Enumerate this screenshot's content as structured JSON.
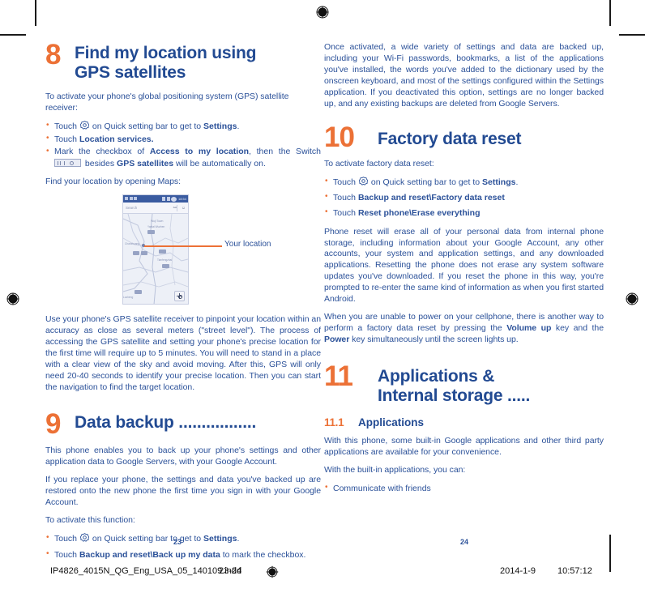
{
  "document": {
    "left_page": {
      "chapters": [
        {
          "number": "8",
          "title_line1": "Find my location using",
          "title_line2": "GPS satellites",
          "intro": "To activate your phone's global positioning system (GPS) satellite receiver:",
          "bullets": [
            {
              "pre": "Touch ",
              "icon": "gear-icon",
              "mid": " on Quick setting bar to get to ",
              "bold": "Settings",
              "post": "."
            },
            {
              "pre": "Touch ",
              "bold": "Location services.",
              "post": ""
            },
            {
              "pre": "Mark the checkbox of ",
              "bold": "Access to my location",
              "mid2": ", then the Switch ",
              "icon2": "toggle-switch-icon",
              "mid3": " besides ",
              "bold2": "GPS satellites",
              "post": " will be automatically on."
            }
          ],
          "after_bullets": "Find your location by opening Maps:",
          "figure": {
            "callout_label": "Your location",
            "search_placeholder": "Search",
            "status_time": "18:54"
          },
          "body_after_figure": "Use your phone's GPS satellite receiver to pinpoint your location within an accuracy as close as several meters (\"street level\"). The process of accessing the GPS satellite and setting your phone's precise location for the first time will require up to 5 minutes. You will need to stand in a place with a clear view of the sky and avoid moving. After this, GPS will only need 20-40 seconds to identify your precise location. Then you can start the navigation to find the target location."
        },
        {
          "number": "9",
          "title_line1": "Data backup .................",
          "paragraphs": [
            "This phone enables you to back up your phone's settings and other application data to Google Servers, with your Google Account.",
            "If you replace your phone, the settings and data you've backed up are restored onto the new phone the first time you sign in with your Google Account.",
            "To activate this function:"
          ],
          "bullets": [
            {
              "pre": "Touch ",
              "icon": "gear-icon",
              "mid": " on Quick setting bar to get to ",
              "bold": "Settings",
              "post": "."
            },
            {
              "pre": "Touch ",
              "bold": "Backup and reset\\Back up my data",
              "post": " to mark the checkbox."
            }
          ]
        }
      ],
      "folio": "23"
    },
    "right_page": {
      "top_paragraph": "Once activated, a wide variety of settings and data are backed up, including your Wi-Fi passwords, bookmarks, a list of the applications you've installed, the words you've added to the dictionary used by the onscreen keyboard, and most of the settings configured within the Settings application. If you deactivated this option, settings are no longer backed up, and any existing backups are deleted from Google Servers.",
      "chapters": [
        {
          "number": "10",
          "title_line1": "Factory data reset",
          "intro": "To activate factory data reset:",
          "bullets": [
            {
              "pre": "Touch ",
              "icon": "gear-icon",
              "mid": " on Quick setting bar to get to ",
              "bold": "Settings",
              "post": "."
            },
            {
              "pre": "Touch ",
              "bold": "Backup and reset\\Factory data reset",
              "post": ""
            },
            {
              "pre": "Touch ",
              "bold": "Reset phone\\Erase everything",
              "post": ""
            }
          ],
          "paragraphs": [
            "Phone reset will erase all of your personal data from internal phone storage, including information about your Google Account, any other accounts, your system and application settings, and any downloaded applications. Resetting the phone does not erase any system software updates you've downloaded. If you reset the phone in this way, you're prompted to re-enter the same kind of information as when you first started Android."
          ],
          "final_paragraph": {
            "pre": "When you are unable to power on your cellphone, there is another way to perform a factory data reset by pressing the ",
            "bold1": "Volume up",
            "mid": " key and the ",
            "bold2": "Power",
            "post": " key simultaneously until the screen lights up."
          }
        },
        {
          "number": "11",
          "title_line1": "Applications &",
          "title_line2": "Internal storage .....",
          "subsection": {
            "number": "11.1",
            "title": "Applications"
          },
          "paragraphs": [
            "With this phone, some built-in Google applications and other third party applications are available for your convenience.",
            "With the built-in applications, you can:"
          ],
          "bullets": [
            {
              "pre": "Communicate with friends",
              "bold": "",
              "post": ""
            }
          ]
        }
      ],
      "folio": "24"
    }
  },
  "print_footer": {
    "filename": "IP4826_4015N_QG_Eng_USA_05_140109.indd",
    "page_range": "23-24",
    "date": "2014-1-9",
    "time": "10:57:12"
  },
  "colors": {
    "orange": "#EC7136",
    "blue": "#224A92",
    "body_blue": "#2B5199"
  }
}
